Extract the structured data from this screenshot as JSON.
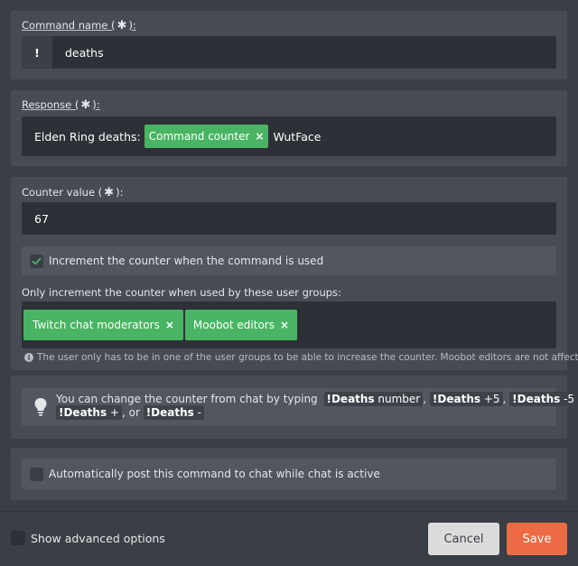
{
  "command_name": {
    "label": "Command name (",
    "label_end": "):",
    "prefix": "!",
    "value": "deaths"
  },
  "response": {
    "label": "Response (",
    "label_end": "):",
    "text_before": "Elden Ring deaths:",
    "tag_label": "Command counter",
    "tag_remove": "×",
    "text_after": "WutFace"
  },
  "counter": {
    "label": "Counter value (",
    "label_end": "):",
    "value": "67",
    "increment_label": "Increment the counter when the command is used",
    "increment_checked": true,
    "groups_label": "Only increment the counter when used by these user groups:",
    "groups": [
      {
        "label": "Twitch chat moderators",
        "remove": "×"
      },
      {
        "label": "Moobot editors",
        "remove": "×"
      }
    ],
    "groups_note": "The user only has to be in one of the user groups to be able to increase the counter. Moobot editors are not affected."
  },
  "tip": {
    "intro": "You can change the counter from chat by typing",
    "c1_bold": "!Deaths",
    "c1_norm": " number",
    "sep1": ",",
    "c2_bold": "!Deaths",
    "c2_norm": " +5",
    "sep2": ",",
    "c3_bold": "!Deaths",
    "c3_norm": " -5",
    "sep3": ",",
    "c4_bold": "!Deaths",
    "c4_norm": " +",
    "sep4": ", or",
    "c5_bold": "!Deaths",
    "c5_norm": " -"
  },
  "auto_post": {
    "label": "Automatically post this command to chat while chat is active",
    "checked": false
  },
  "footer": {
    "advanced_label": "Show advanced options",
    "cancel_label": "Cancel",
    "save_label": "Save"
  },
  "colors": {
    "tag_green": "#49b463",
    "save_orange": "#ee6a45",
    "cancel_gray": "#dcdcdc",
    "check_green": "#49b463"
  },
  "icons": {
    "required": "asterisk-icon",
    "remove": "close-icon",
    "info": "info-icon",
    "tip": "lightbulb-icon",
    "check": "checkmark-icon"
  }
}
